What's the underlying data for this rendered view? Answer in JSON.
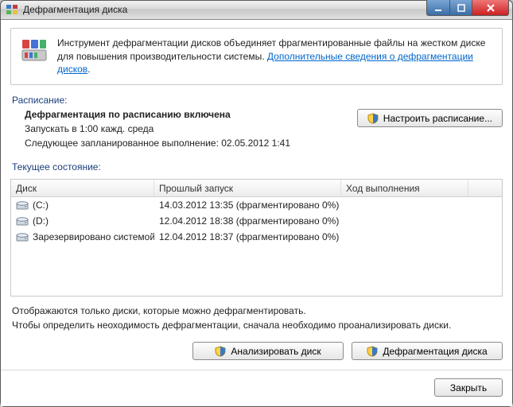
{
  "window": {
    "title": "Дефрагментация диска"
  },
  "info": {
    "text_before_link": "Инструмент дефрагментации дисков объединяет фрагментированные файлы на жестком диске для повышения производительности системы. ",
    "link": "Дополнительные сведения о дефрагментации дисков"
  },
  "schedule": {
    "section_label": "Расписание:",
    "status": "Дефрагментация по расписанию включена",
    "run_at": "Запускать в 1:00 кажд. среда",
    "next_run": "Следующее запланированное выполнение: 02.05.2012 1:41",
    "configure_btn": "Настроить расписание..."
  },
  "current": {
    "section_label": "Текущее состояние:",
    "columns": {
      "disk": "Диск",
      "last_run": "Прошлый запуск",
      "progress": "Ход выполнения"
    },
    "rows": [
      {
        "name": "(C:)",
        "last_run": "14.03.2012 13:35 (фрагментировано 0%)",
        "progress": ""
      },
      {
        "name": "(D:)",
        "last_run": "12.04.2012 18:38 (фрагментировано 0%)",
        "progress": ""
      },
      {
        "name": "Зарезервировано системой",
        "last_run": "12.04.2012 18:37 (фрагментировано 0%)",
        "progress": ""
      }
    ]
  },
  "hint": {
    "line1": "Отображаются только диски, которые можно дефрагментировать.",
    "line2": "Чтобы определить неоходимость  дефрагментации, сначала необходимо проанализировать диски."
  },
  "buttons": {
    "analyze": "Анализировать диск",
    "defrag": "Дефрагментация диска",
    "close": "Закрыть"
  }
}
